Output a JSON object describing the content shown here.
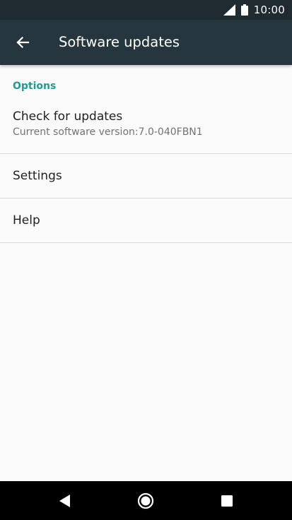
{
  "status_bar": {
    "time": "10:00"
  },
  "app_bar": {
    "title": "Software updates"
  },
  "section": {
    "header": "Options"
  },
  "items": [
    {
      "title": "Check for updates",
      "subtitle": "Current software version:7.0-040FBN1"
    },
    {
      "title": "Settings"
    },
    {
      "title": "Help"
    }
  ],
  "colors": {
    "accent": "#1e9c93",
    "app_bar": "#26363f",
    "status_bar": "#1f2a31"
  },
  "icons": [
    "signal-icon",
    "battery-icon",
    "back-arrow-icon",
    "nav-back-icon",
    "nav-home-icon",
    "nav-recents-icon"
  ]
}
